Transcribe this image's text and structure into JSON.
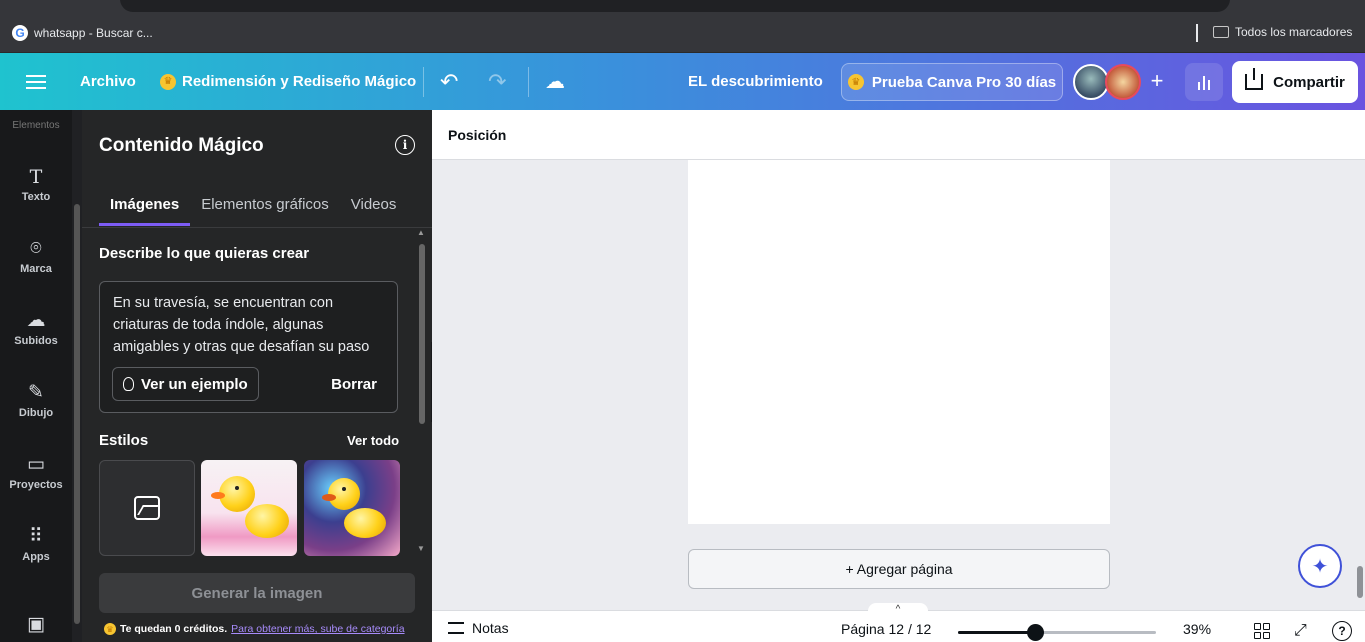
{
  "browser": {
    "bookmark_item": "whatsapp - Buscar c...",
    "bookmarks_all": "Todos los marcadores"
  },
  "topbar": {
    "menu_icon": "hamburger-icon",
    "archivo": "Archivo",
    "resize": "Redimensión y Rediseño Mágico",
    "title": "EL descubrimiento",
    "pro": "Prueba Canva Pro 30 días",
    "share": "Compartir",
    "accent_gradient": [
      "#1fc3cf",
      "#3a90dc",
      "#6a53e0"
    ]
  },
  "rail": {
    "cut_label": "Elementos",
    "items": [
      {
        "label": "Texto",
        "icon": "text-icon"
      },
      {
        "label": "Marca",
        "icon": "brand-icon"
      },
      {
        "label": "Subidos",
        "icon": "upload-cloud-icon"
      },
      {
        "label": "Dibujo",
        "icon": "draw-icon"
      },
      {
        "label": "Proyectos",
        "icon": "folder-icon"
      },
      {
        "label": "Apps",
        "icon": "apps-grid-icon"
      }
    ]
  },
  "panel": {
    "title": "Contenido Mágico",
    "tabs": [
      "Imágenes",
      "Elementos gráficos",
      "Videos"
    ],
    "active_tab": "Imágenes",
    "describe_label": "Describe lo que quieras crear",
    "prompt_value": "En su travesía, se encuentran con criaturas de toda índole, algunas amigables y otras que desafían su paso",
    "example_btn": "Ver un ejemplo",
    "clear_btn": "Borrar",
    "styles_label": "Estilos",
    "see_all": "Ver todo",
    "generate_btn": "Generar la imagen",
    "credits_text": "Te quedan 0 créditos.",
    "credits_link": "Para obtener más, sube de categoría",
    "accent": "#7d5cf5"
  },
  "workspace": {
    "position_label": "Posición",
    "add_page": "+ Agregar página",
    "notes": "Notas",
    "page_indicator": "Página 12 / 12",
    "zoom": "39%",
    "zoom_fraction": 0.39
  }
}
